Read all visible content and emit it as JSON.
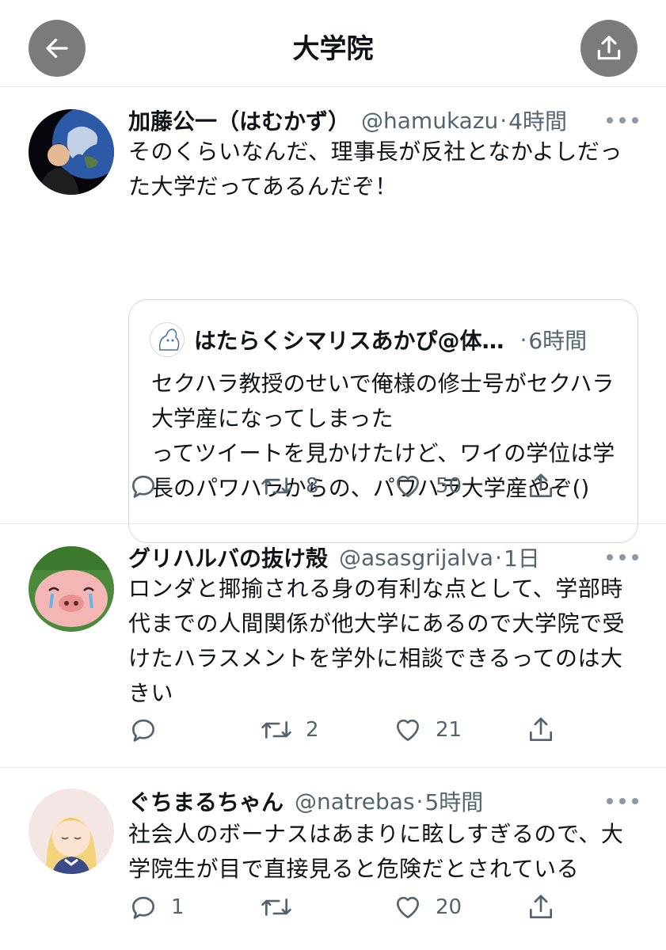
{
  "header": {
    "title": "大学院",
    "back_icon": "arrow-left-icon",
    "share_icon": "share-upload-icon"
  },
  "tweets": [
    {
      "name": "加藤公一（はむかず）",
      "handle": "@hamukazu",
      "sep": "·",
      "time": "4時間",
      "text": "そのくらいなんだ、理事長が反社となかよしだった大学だってあるんだぞ！",
      "quote": {
        "name": "はたらくシマリスあかぴ@体…",
        "sep": "·",
        "time": "6時間",
        "text": "セクハラ教授のせいで俺様の修士号がセクハラ大学産になってしまった\nってツイートを見かけたけど、ワイの学位は学長のパワハラからの、パワハラ大学産やぞ()"
      },
      "replies": "",
      "retweets": "8",
      "likes": "50"
    },
    {
      "name": "グリハルバの抜け殻",
      "handle": "@asasgrijalva",
      "sep": "·",
      "time": "1日",
      "text": "ロンダと揶揄される身の有利な点として、学部時代までの人間関係が他大学にあるので大学院で受けたハラスメントを学外に相談できるってのは大きい",
      "replies": "",
      "retweets": "2",
      "likes": "21"
    },
    {
      "name": "ぐちまるちゃん",
      "handle": "@natrebas",
      "sep": "·",
      "time": "5時間",
      "text": "社会人のボーナスはあまりに眩しすぎるので、大学院生が目で直接見ると危険だとされている",
      "replies": "1",
      "retweets": "",
      "likes": "20"
    }
  ],
  "icons": {
    "reply": "reply-bubble-icon",
    "retweet": "retweet-icon",
    "like": "heart-icon",
    "share": "share-icon",
    "more": "more-dots-icon"
  },
  "colors": {
    "text": "#0f1419",
    "secondary": "#536471",
    "border": "#e6e9ec",
    "header_button": "#7b7b7b"
  }
}
